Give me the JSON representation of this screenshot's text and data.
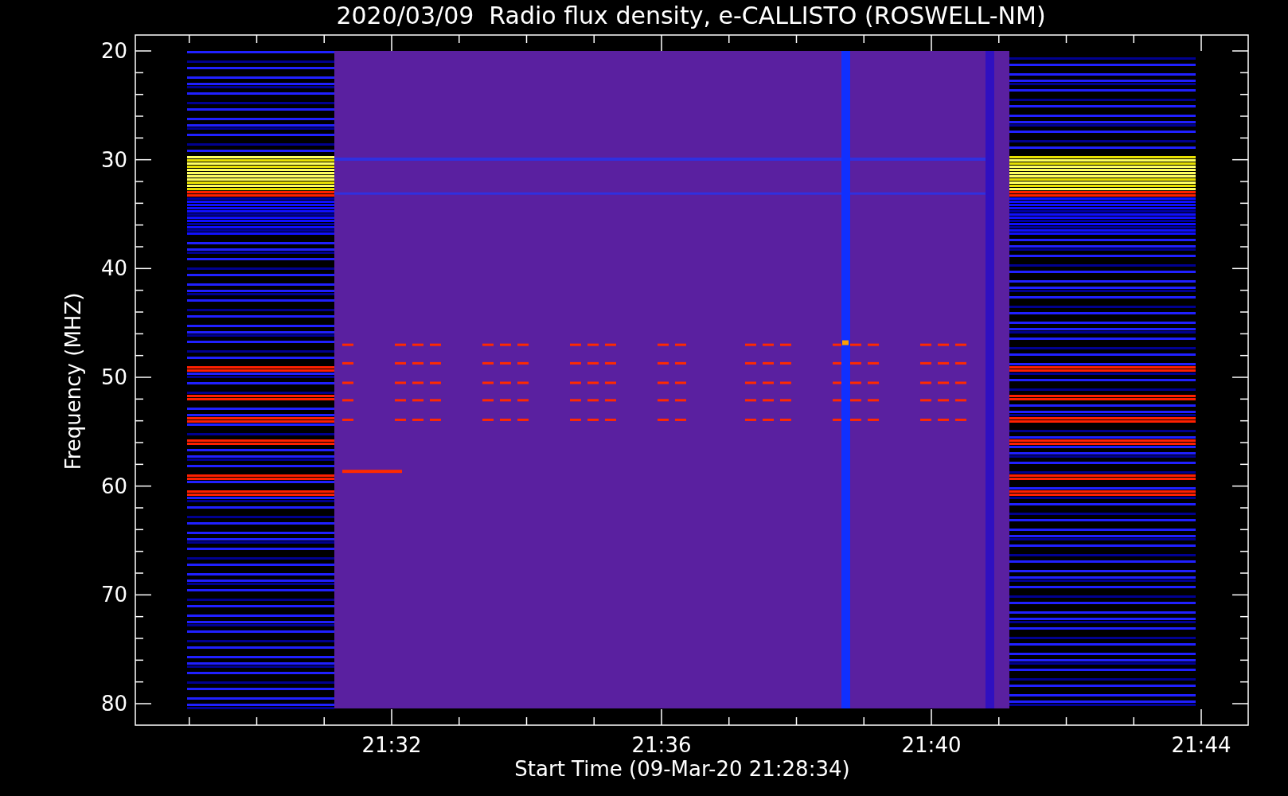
{
  "title": "2020/03/09  Radio flux density, e-CALLISTO (ROSWELL-NM)",
  "y_axis": {
    "label": "Frequency (MHZ)",
    "ticks": [
      "20",
      "30",
      "40",
      "50",
      "60",
      "70",
      "80"
    ]
  },
  "x_axis": {
    "label": "Start Time (09-Mar-20 21:28:34)",
    "ticks": [
      "21:32",
      "21:36",
      "21:40",
      "21:44"
    ]
  }
}
